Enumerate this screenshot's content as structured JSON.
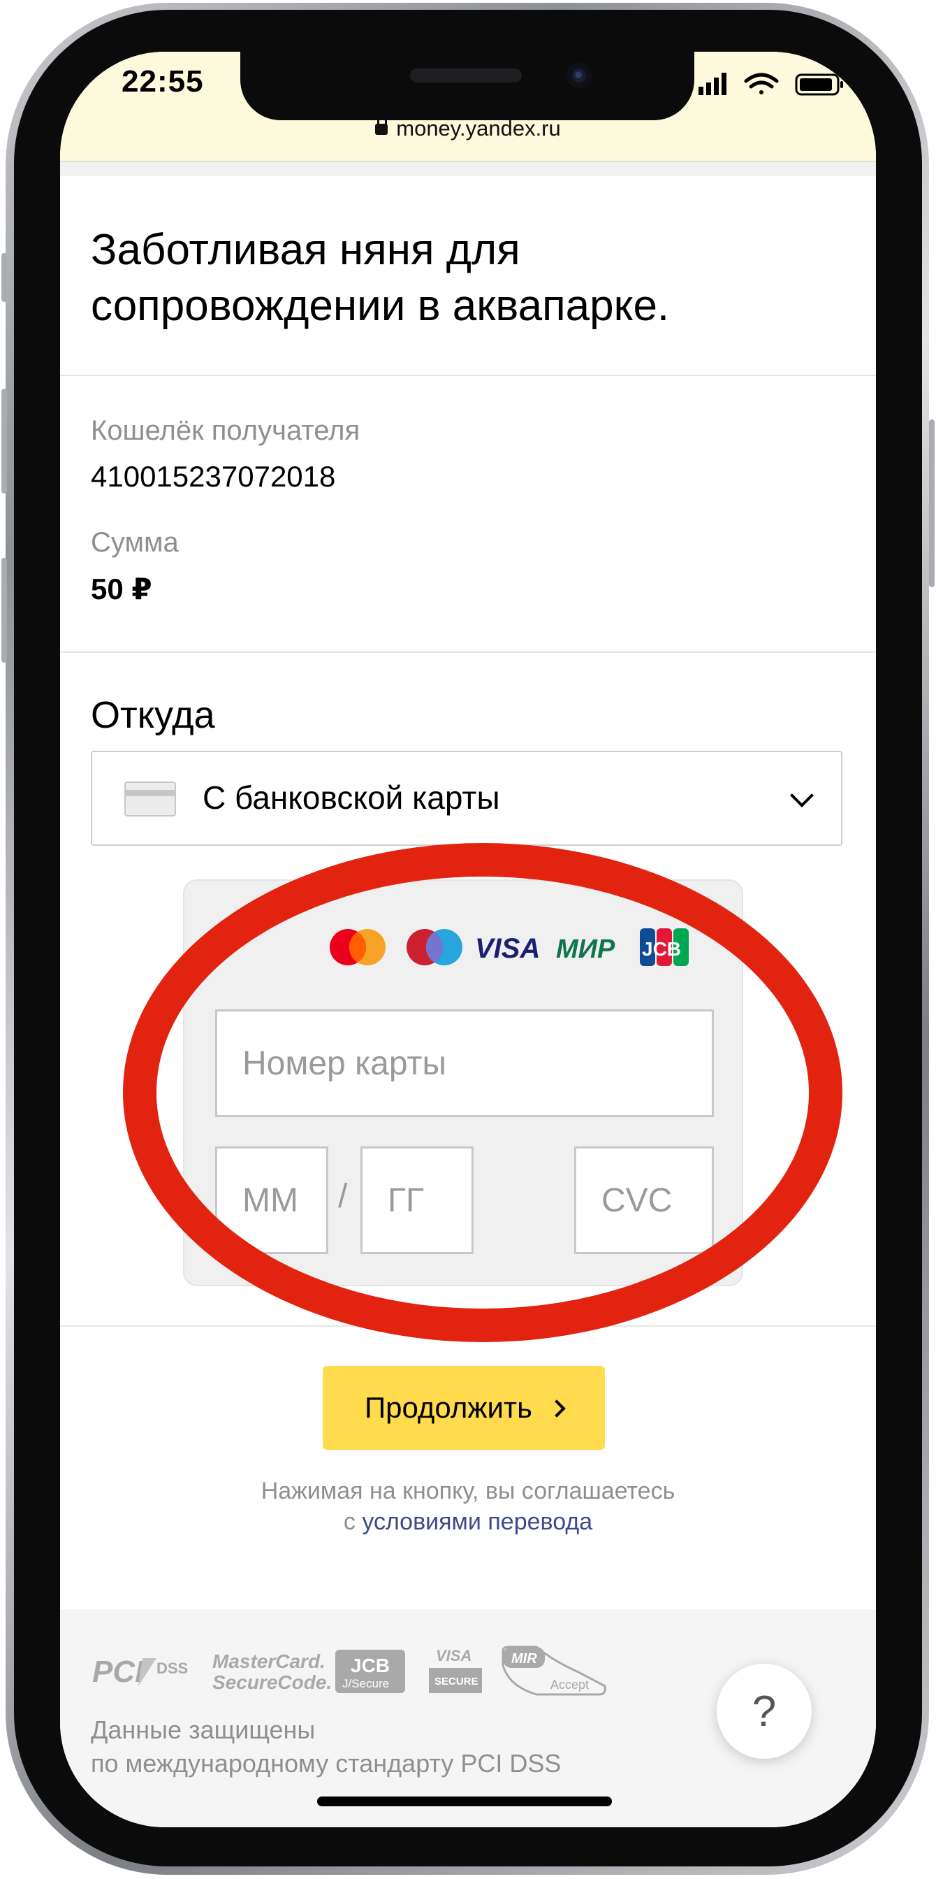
{
  "status_bar": {
    "time": "22:55"
  },
  "browser": {
    "url": "money.yandex.ru"
  },
  "payment": {
    "title": "Заботливая няня для сопровождении в аквапарке.",
    "wallet_label": "Кошелёк получателя",
    "wallet_number": "410015237072018",
    "amount_label": "Сумма",
    "amount_value": "50 ₽"
  },
  "source": {
    "section_title": "Откуда",
    "selected": "С банковской карты"
  },
  "card_form": {
    "brands": [
      "mastercard-logo",
      "maestro-logo",
      "visa-logo",
      "mir-logo",
      "jcb-logo"
    ],
    "visa_text": "VISA",
    "mir_text": "МИР",
    "jcb_text": "JCB",
    "card_number_placeholder": "Номер карты",
    "month_placeholder": "ММ",
    "year_placeholder": "ГГ",
    "separator": "/",
    "cvc_placeholder": "CVC"
  },
  "continue": {
    "label": "Продолжить",
    "agree_line1": "Нажимая на кнопку, вы соглашаетесь",
    "agree_prefix": "с ",
    "agree_link": "условиями перевода"
  },
  "footer": {
    "security_logos": {
      "pci": "PCI",
      "dss": "DSS",
      "mastercard_line1": "MasterCard.",
      "mastercard_line2": "SecureCode.",
      "jcb": "JCB",
      "jcb_secure": "J/Secure",
      "visa": "VISA",
      "visa_secure": "SECURE",
      "mir": "MIR",
      "mir_accept": "Accept"
    },
    "line1": "Данные защищены",
    "line2": "по международному стандарту PCI DSS",
    "help": "?"
  },
  "colors": {
    "accent_yellow": "#ffdb4d",
    "highlight_red": "#e2230f",
    "link_blue": "#3d4b8c",
    "topbar_bg": "#fdf9dc"
  }
}
